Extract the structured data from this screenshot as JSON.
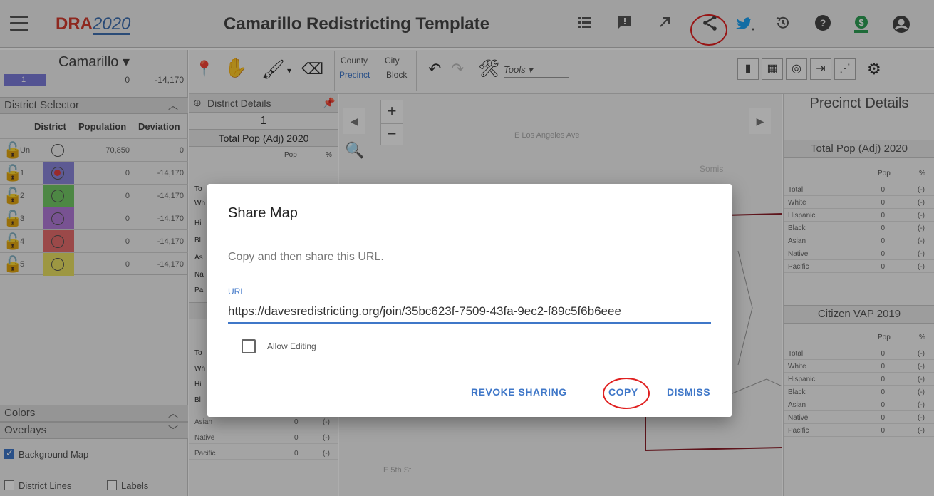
{
  "header": {
    "logo_prefix": "DRA",
    "logo_year": "2020",
    "title": "Camarillo Redistricting Template",
    "icons": [
      "menu-icon",
      "list-icon",
      "feedback-icon",
      "expand-icon",
      "share-icon",
      "twitter-icon",
      "history-icon",
      "help-icon",
      "account-dollar-icon",
      "account-circle-icon"
    ],
    "colors": {
      "logo_red": "#d23b2f",
      "logo_blue": "#3f6fb0",
      "twitter": "#1da1f2",
      "highlight_ring": "#e02020"
    }
  },
  "left_panel": {
    "title": "Camarillo ▾",
    "summary": {
      "district": "1",
      "population": "0",
      "deviation": "-14,170"
    },
    "district_selector": {
      "title": "District Selector",
      "columns": [
        "District",
        "Population",
        "Deviation"
      ],
      "rows": [
        {
          "district": "Un",
          "population": "70,850",
          "deviation": "0",
          "color": "#efefef"
        },
        {
          "district": "1",
          "population": "0",
          "deviation": "-14,170",
          "color": "#8a85d9"
        },
        {
          "district": "2",
          "population": "0",
          "deviation": "-14,170",
          "color": "#72c765"
        },
        {
          "district": "3",
          "population": "0",
          "deviation": "-14,170",
          "color": "#b27ad8"
        },
        {
          "district": "4",
          "population": "0",
          "deviation": "-14,170",
          "color": "#e56c6c"
        },
        {
          "district": "5",
          "population": "0",
          "deviation": "-14,170",
          "color": "#e8df62"
        }
      ]
    },
    "colors_section": "Colors",
    "overlays_section": "Overlays",
    "background_map": "Background Map",
    "district_lines": "District Lines",
    "labels": "Labels"
  },
  "toolbar": {
    "county": "County",
    "city": "City",
    "precinct": "Precinct",
    "block": "Block",
    "tools": "Tools ▾"
  },
  "district_details": {
    "title": "District Details",
    "district": "1",
    "section": "Total Pop (Adj) 2020",
    "pop_col": "Pop",
    "pct_col": "%",
    "row_stubs": [
      "To",
      "Wh",
      "Hi",
      "Bl",
      "As",
      "Na",
      "Pa"
    ],
    "rows2_stubs": [
      "To",
      "Wh",
      "Hi",
      "Bl"
    ],
    "bottom_rows": [
      {
        "label": "Asian",
        "value": "0",
        "pct": "(-)"
      },
      {
        "label": "Native",
        "value": "0",
        "pct": "(-)"
      },
      {
        "label": "Pacific",
        "value": "0",
        "pct": "(-)"
      }
    ]
  },
  "map": {
    "street_top": "E Los Angeles Ave",
    "street_bottom": "E 5th St",
    "place": "Somis",
    "zoom_in": "+",
    "zoom_out": "−"
  },
  "precinct_details": {
    "title": "Precinct Details",
    "section1": "Total Pop (Adj) 2020",
    "section2": "Citizen VAP 2019",
    "pop_col": "Pop",
    "pct_col": "%",
    "rows1": [
      {
        "label": "Total",
        "value": "0",
        "pct": "(-)"
      },
      {
        "label": "White",
        "value": "0",
        "pct": "(-)"
      },
      {
        "label": "Hispanic",
        "value": "0",
        "pct": "(-)"
      },
      {
        "label": "Black",
        "value": "0",
        "pct": "(-)"
      },
      {
        "label": "Asian",
        "value": "0",
        "pct": "(-)"
      },
      {
        "label": "Native",
        "value": "0",
        "pct": "(-)"
      },
      {
        "label": "Pacific",
        "value": "0",
        "pct": "(-)"
      }
    ],
    "rows2": [
      {
        "label": "Total",
        "value": "0",
        "pct": "(-)"
      },
      {
        "label": "White",
        "value": "0",
        "pct": "(-)"
      },
      {
        "label": "Hispanic",
        "value": "0",
        "pct": "(-)"
      },
      {
        "label": "Black",
        "value": "0",
        "pct": "(-)"
      },
      {
        "label": "Asian",
        "value": "0",
        "pct": "(-)"
      },
      {
        "label": "Native",
        "value": "0",
        "pct": "(-)"
      },
      {
        "label": "Pacific",
        "value": "0",
        "pct": "(-)"
      }
    ]
  },
  "dialog": {
    "title": "Share Map",
    "text": "Copy and then share this URL.",
    "url_label": "URL",
    "url_value": "https://davesredistricting.org/join/35bc623f-7509-43fa-9ec2-f89c5f6b6eee",
    "allow_editing": "Allow Editing",
    "revoke": "REVOKE SHARING",
    "copy": "COPY",
    "dismiss": "DISMISS",
    "accent": "#3f77c8"
  }
}
